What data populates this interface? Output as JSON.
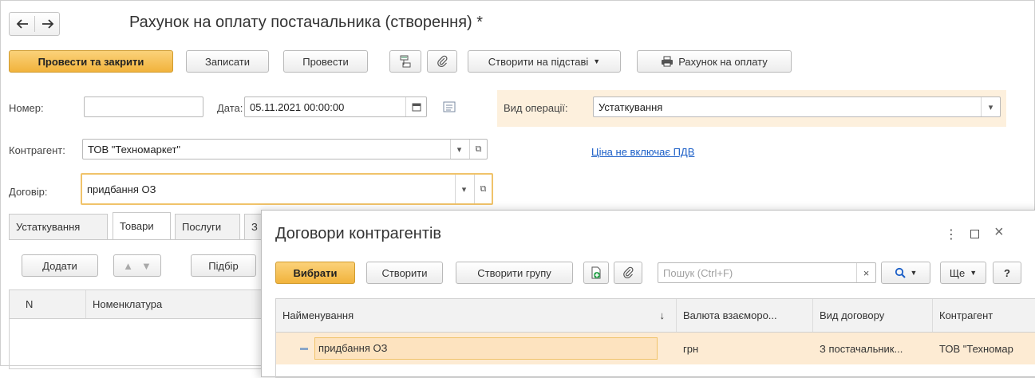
{
  "header": {
    "back_icon": "arrow-left-icon",
    "forward_icon": "arrow-right-icon",
    "title": "Рахунок на оплату постачальника (створення) *"
  },
  "toolbar": {
    "post_close_label": "Провести та закрити",
    "save_label": "Записати",
    "post_label": "Провести",
    "create_based_label": "Створити на підставі",
    "print_invoice_label": "Рахунок на оплату"
  },
  "form": {
    "number_label": "Номер:",
    "number_value": "",
    "date_label": "Дата:",
    "date_value": "05.11.2021 00:00:00",
    "operation_label": "Вид операції:",
    "operation_value": "Устаткування",
    "counterparty_label": "Контрагент:",
    "counterparty_value": "ТОВ \"Техномаркет\"",
    "vat_link": "Ціна не включає ПДВ",
    "contract_label": "Договір:",
    "contract_value": "придбання ОЗ"
  },
  "tabs": [
    {
      "label": "Устаткування"
    },
    {
      "label": "Товари"
    },
    {
      "label": "Послуги"
    },
    {
      "label": "З"
    }
  ],
  "items_toolbar": {
    "add_label": "Додати",
    "selection_label": "Підбір"
  },
  "items_table": {
    "columns": [
      "N",
      "Номенклатура"
    ]
  },
  "dialog": {
    "title": "Договори контрагентів",
    "select_label": "Вибрати",
    "create_label": "Створити",
    "create_group_label": "Створити групу",
    "search_placeholder": "Пошук (Ctrl+F)",
    "more_label": "Ще",
    "help_label": "?",
    "columns": [
      "Найменування",
      "Валюта взаєморо...",
      "Вид договору",
      "Контрагент"
    ],
    "sort_indicator": "↓",
    "rows": [
      {
        "name": "придбання ОЗ",
        "currency": "грн",
        "type": "З постачальник...",
        "counterparty": "ТОВ \"Техномар"
      }
    ]
  },
  "colors": {
    "primary_button": "#f1b33c",
    "operation_highlight": "#fdf0dd",
    "selected_row": "#fdebd3",
    "link": "#1a5ec7",
    "focus_border": "#f0c36a"
  }
}
